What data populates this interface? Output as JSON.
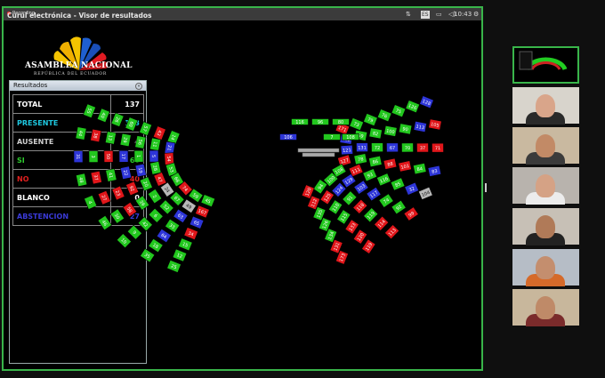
{
  "window": {
    "title": "Curul electrónica - Visor de resultados",
    "recording_label": "Recording",
    "time": "10:43",
    "keyboard_layout": "ES"
  },
  "logo": {
    "name": "ASAMBLEA NACIONAL",
    "subtitle": "REPÚBLICA DEL ECUADOR"
  },
  "results_panel": {
    "header": "Resultados",
    "rows": [
      {
        "label": "TOTAL",
        "value": "137",
        "color": "#ffffff"
      },
      {
        "label": "PRESENTE",
        "value": "133",
        "color": "#1ec8e0"
      },
      {
        "label": "AUSENTE",
        "value": "4",
        "color": "#cfcfcf"
      },
      {
        "label": "SI",
        "value": "66",
        "color": "#2ecc2e"
      },
      {
        "label": "NO",
        "value": "40",
        "color": "#e0201f"
      },
      {
        "label": "BLANCO",
        "value": "0",
        "color": "#ffffff"
      },
      {
        "label": "ABSTENCION",
        "value": "27",
        "color": "#3a3ad8"
      }
    ]
  },
  "top_seats": {
    "row1": [
      "116",
      "96",
      "80"
    ],
    "row2": [
      "106",
      "7",
      "108"
    ]
  },
  "seat_colors": {
    "si": "#22c71e",
    "no": "#e0161a",
    "abstencion": "#2d35d8",
    "ausente": "#b8b8b8"
  },
  "left_rows": [
    [
      "55",
      "44",
      "31",
      "48",
      "4",
      "46",
      "10",
      "35",
      "25"
    ],
    [
      "40",
      "38",
      "3",
      "37",
      "27",
      "30",
      "9",
      "18",
      "12"
    ],
    [
      "26",
      "13",
      "50",
      "41",
      "23",
      "58",
      "42",
      "64",
      "15"
    ],
    [
      "60",
      "29",
      "17",
      "22",
      "92",
      "39",
      "6",
      "33",
      "34"
    ],
    [
      "57",
      "56",
      "1",
      "19",
      "20",
      "2",
      "52",
      "63",
      "65"
    ],
    [
      "43",
      "11",
      "5",
      "28",
      "47",
      "24",
      "67",
      "49",
      "167"
    ],
    [
      "14",
      "21",
      "54",
      "53",
      "68",
      "74",
      "59",
      "45"
    ]
  ],
  "left_status": [
    [
      "si",
      "si",
      "abstencion",
      "si",
      "si",
      "si",
      "si",
      "si",
      "si"
    ],
    [
      "si",
      "no",
      "si",
      "no",
      "no",
      "si",
      "si",
      "si",
      "si"
    ],
    [
      "si",
      "si",
      "no",
      "si",
      "no",
      "no",
      "si",
      "abstencion",
      "si"
    ],
    [
      "si",
      "si",
      "abstencion",
      "abstencion",
      "no",
      "si",
      "si",
      "si",
      "no"
    ],
    [
      "si",
      "si",
      "si",
      "abstencion",
      "si",
      "si",
      "si",
      "abstencion",
      "abstencion"
    ],
    [
      "no",
      "si",
      "abstencion",
      "si",
      "no",
      "ausente",
      "si",
      "ausente",
      "no"
    ],
    [
      "si",
      "abstencion",
      "no",
      "si",
      "si",
      "no",
      "si",
      "si"
    ]
  ],
  "right_rows": [
    [
      "128",
      "105",
      "71",
      "83",
      "104",
      "99",
      "113",
      "119",
      "173"
    ],
    [
      "126",
      "113",
      "37",
      "84",
      "32",
      "92",
      "114",
      "120",
      "131"
    ],
    [
      "75",
      "90",
      "70",
      "101",
      "85",
      "74",
      "119",
      "133",
      "134"
    ],
    [
      "76",
      "100",
      "67",
      "88",
      "116",
      "117",
      "118",
      "115",
      "126"
    ],
    [
      "79",
      "82",
      "72",
      "86",
      "93",
      "103",
      "91",
      "110",
      "135"
    ],
    [
      "73",
      "69",
      "131",
      "78",
      "111",
      "129",
      "124",
      "125",
      "112"
    ],
    [
      "171",
      "122",
      "121",
      "127",
      "108",
      "100",
      "94",
      "120"
    ]
  ],
  "right_status": [
    [
      "abstencion",
      "no",
      "no",
      "abstencion",
      "ausente",
      "no",
      "no",
      "no",
      "no"
    ],
    [
      "si",
      "abstencion",
      "no",
      "si",
      "abstencion",
      "si",
      "no",
      "no",
      "no"
    ],
    [
      "si",
      "si",
      "si",
      "no",
      "si",
      "si",
      "si",
      "no",
      "si"
    ],
    [
      "si",
      "si",
      "abstencion",
      "no",
      "si",
      "abstencion",
      "no",
      "si",
      "si"
    ],
    [
      "si",
      "si",
      "si",
      "si",
      "si",
      "abstencion",
      "si",
      "si",
      "si"
    ],
    [
      "si",
      "si",
      "abstencion",
      "si",
      "no",
      "abstencion",
      "abstencion",
      "no",
      "no"
    ],
    [
      "no",
      "abstencion",
      "abstencion",
      "no",
      "si",
      "si",
      "si",
      "no"
    ]
  ],
  "participants": [
    "participant-1",
    "participant-2",
    "participant-3",
    "participant-4",
    "participant-5",
    "participant-6"
  ],
  "participant_colors": [
    {
      "bg": "#d8d4cc",
      "face": "#d9a58a",
      "body": "#2a2a2a"
    },
    {
      "bg": "#c9b9a0",
      "face": "#c28a66",
      "body": "#3b3b3b"
    },
    {
      "bg": "#b8b3ad",
      "face": "#d5a285",
      "body": "#ececec"
    },
    {
      "bg": "#c7c0b6",
      "face": "#b07a58",
      "body": "#222222"
    },
    {
      "bg": "#b6bdc6",
      "face": "#c48e6e",
      "body": "#d56a2a"
    },
    {
      "bg": "#c8b79c",
      "face": "#bf8a68",
      "body": "#7a2b2b"
    }
  ]
}
